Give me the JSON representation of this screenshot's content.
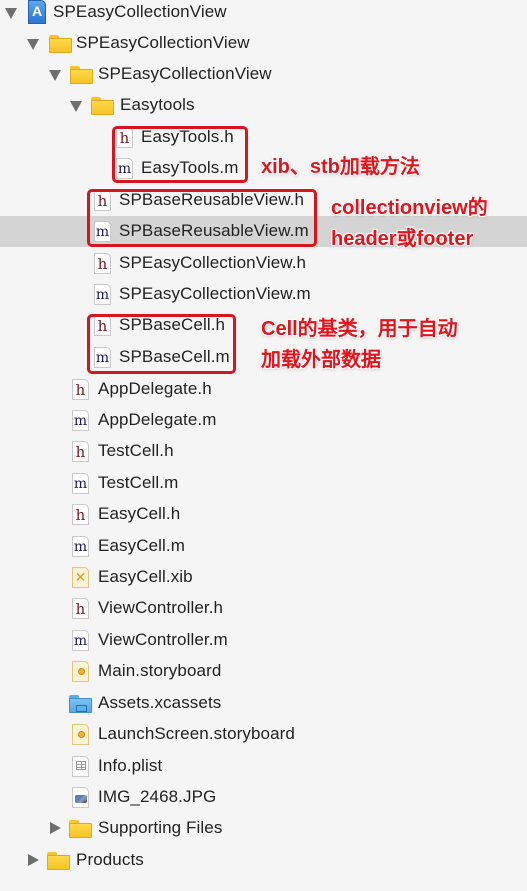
{
  "navigator": {
    "project": {
      "label": "SPEasyCollectionView",
      "icon": "xcode-project-icon",
      "expanded": true
    },
    "rows": [
      {
        "label": "SPEasyCollectionView",
        "type": "folder",
        "expanded": true
      },
      {
        "label": "SPEasyCollectionView",
        "type": "folder",
        "expanded": true
      },
      {
        "label": "Easytools",
        "type": "folder",
        "expanded": true
      },
      {
        "label": "EasyTools.h",
        "type": "h"
      },
      {
        "label": "EasyTools.m",
        "type": "m"
      },
      {
        "label": "SPBaseReusableView.h",
        "type": "h"
      },
      {
        "label": "SPBaseReusableView.m",
        "type": "m",
        "selected": true
      },
      {
        "label": "SPEasyCollectionView.h",
        "type": "h"
      },
      {
        "label": "SPEasyCollectionView.m",
        "type": "m"
      },
      {
        "label": "SPBaseCell.h",
        "type": "h"
      },
      {
        "label": "SPBaseCell.m",
        "type": "m"
      },
      {
        "label": "AppDelegate.h",
        "type": "h"
      },
      {
        "label": "AppDelegate.m",
        "type": "m"
      },
      {
        "label": "TestCell.h",
        "type": "h"
      },
      {
        "label": "TestCell.m",
        "type": "m"
      },
      {
        "label": "EasyCell.h",
        "type": "h"
      },
      {
        "label": "EasyCell.m",
        "type": "m"
      },
      {
        "label": "EasyCell.xib",
        "type": "xib"
      },
      {
        "label": "ViewController.h",
        "type": "h"
      },
      {
        "label": "ViewController.m",
        "type": "m"
      },
      {
        "label": "Main.storyboard",
        "type": "storyboard"
      },
      {
        "label": "Assets.xcassets",
        "type": "xcassets"
      },
      {
        "label": "LaunchScreen.storyboard",
        "type": "storyboard"
      },
      {
        "label": "Info.plist",
        "type": "plist"
      },
      {
        "label": "IMG_2468.JPG",
        "type": "image"
      },
      {
        "label": "Supporting Files",
        "type": "folder",
        "expanded": false
      },
      {
        "label": "Products",
        "type": "folder",
        "expanded": false
      }
    ],
    "file_glyphs": {
      "h": "h",
      "m": "m",
      "xib": "✕"
    }
  },
  "annotations": {
    "easytools": "xib、stb加载方法",
    "reusable_line1": "collectionview的",
    "reusable_line2": "header或footer",
    "basecell_line1": "Cell的基类，用于自动",
    "basecell_line2": "加载外部数据"
  },
  "colors": {
    "annotation_red": "#e3131b",
    "box_red": "#d8141c",
    "selection": "#d4d4d4",
    "background": "#f5f5f5"
  }
}
